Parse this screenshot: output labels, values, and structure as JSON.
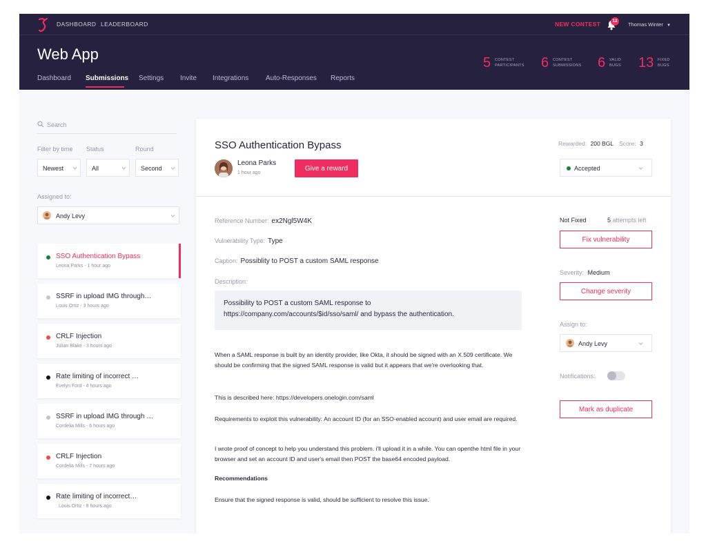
{
  "topbar": {
    "nav": [
      "DASHBOARD",
      "LEADERBOARD"
    ],
    "new_contest": "NEW CONTEST",
    "notification_count": "12",
    "user_name": "Thomas Winter"
  },
  "header": {
    "title": "Web App",
    "tabs": [
      "Dashboard",
      "Submissions",
      "Settings",
      "Invite",
      "Integrations",
      "Auto-Responses",
      "Reports"
    ],
    "active_tab": "Submissions",
    "stats": [
      {
        "value": "5",
        "label_line1": "CONTEST",
        "label_line2": "PARTICIPANTS"
      },
      {
        "value": "6",
        "label_line1": "CONTEST",
        "label_line2": "SUBMISSIONS"
      },
      {
        "value": "6",
        "label_line1": "VALID",
        "label_line2": "BUGS"
      },
      {
        "value": "13",
        "label_line1": "FIXED",
        "label_line2": "BUGS"
      }
    ]
  },
  "sidebar": {
    "search_placeholder": "Search",
    "filters": {
      "time_label": "Filter by time",
      "status_label": "Status",
      "round_label": "Round",
      "time_value": "Newest",
      "status_value": "All",
      "round_value": "Second"
    },
    "assigned_label": "Assigned to:",
    "assigned_value": "Andy Levy",
    "submissions": [
      {
        "title": "SSO Authentication Bypass",
        "meta": "Leona Parks - 1 hour ago",
        "dot_color": "#1e7e34",
        "active": true
      },
      {
        "title": "SSRF in upload IMG through…",
        "meta": "Louis Ortiz - 3 hours ago",
        "dot_color": "#c4c4cc",
        "active": false
      },
      {
        "title": "CRLF Injection",
        "meta": "Julian Blake - 3 hours ago",
        "dot_color": "#ef4b4b",
        "active": false
      },
      {
        "title": "Rate limiting of incorrect …",
        "meta": "Evelyn Ford - 4 hours ago",
        "dot_color": "#111111",
        "active": false
      },
      {
        "title": "SSRF in upload IMG through …",
        "meta": "Cordelia Mills - 6 hours ago",
        "dot_color": "#c4c4cc",
        "active": false
      },
      {
        "title": "CRLF Injection",
        "meta": "Cordelia Mills - 7 hours ago",
        "dot_color": "#ef4b4b",
        "active": false
      },
      {
        "title": "Rate limiting of incorrect…",
        "meta": "Louis Ortiz - 8 hours ago",
        "dot_color": "#111111",
        "active": false
      }
    ]
  },
  "detail": {
    "title": "SSO Authentication Bypass",
    "author": "Leona Parks",
    "time": "1 hour ago",
    "reward_button": "Give a reward",
    "rewarded_label": "Rewarded:",
    "rewarded_value": "200 BGL",
    "score_label": "Score:",
    "score_value": "3",
    "status_value": "Accepted",
    "reference_label": "Reference Number:",
    "reference_value": "ex2Ngl5W4K",
    "vuln_type_label": "Vulnerability Type:",
    "vuln_type_value": "Type",
    "caption_label": "Caption:",
    "caption_value": "Possiblity to POST a custom SAML response",
    "description_label": "Description:",
    "quote_line1": "Possibility to POST a custom SAML response to",
    "quote_line2": "https://company.com/accounts/$id/sso/saml/ and bypass the authentication.",
    "paragraph1": "When a SAML response is built by an identity provider, like Okta, it should be signed with an X.509 certificate. We should be confirming that the signed SAML response is valid but it appears that we're overlooking that.",
    "paragraph2": "This is described here: https://developers.onelogin.com/saml",
    "paragraph3": "Requirements to exploit this vulnerability: An account ID (for an SSO-enabled account) and user email are required.",
    "paragraph4": "I wrote proof of concept to help you understand this problem. i'll upload it in a while. You can openthe html file in your browser and set an account ID and user's email then POST the base64 encoded payload.",
    "recommendations_heading": "Recommendations",
    "recommendations_text": "Ensure that the signed response is valid, should be sufficient to resolve this issue."
  },
  "actions": {
    "fix_status": "Not Fixed",
    "attempts_count": "5",
    "attempts_text": "attempts left",
    "fix_button": "Fix vulnerability",
    "severity_label": "Severity:",
    "severity_value": "Medium",
    "severity_button": "Change severity",
    "assign_label": "Assign to:",
    "assign_value": "Andy Levy",
    "notifications_label": "Notifications:",
    "notifications_on": false,
    "duplicate_button": "Mark as duplicate"
  },
  "colors": {
    "accent": "#ef2d5e",
    "header_bg": "#26213f",
    "accepted_green": "#1e7e34"
  }
}
